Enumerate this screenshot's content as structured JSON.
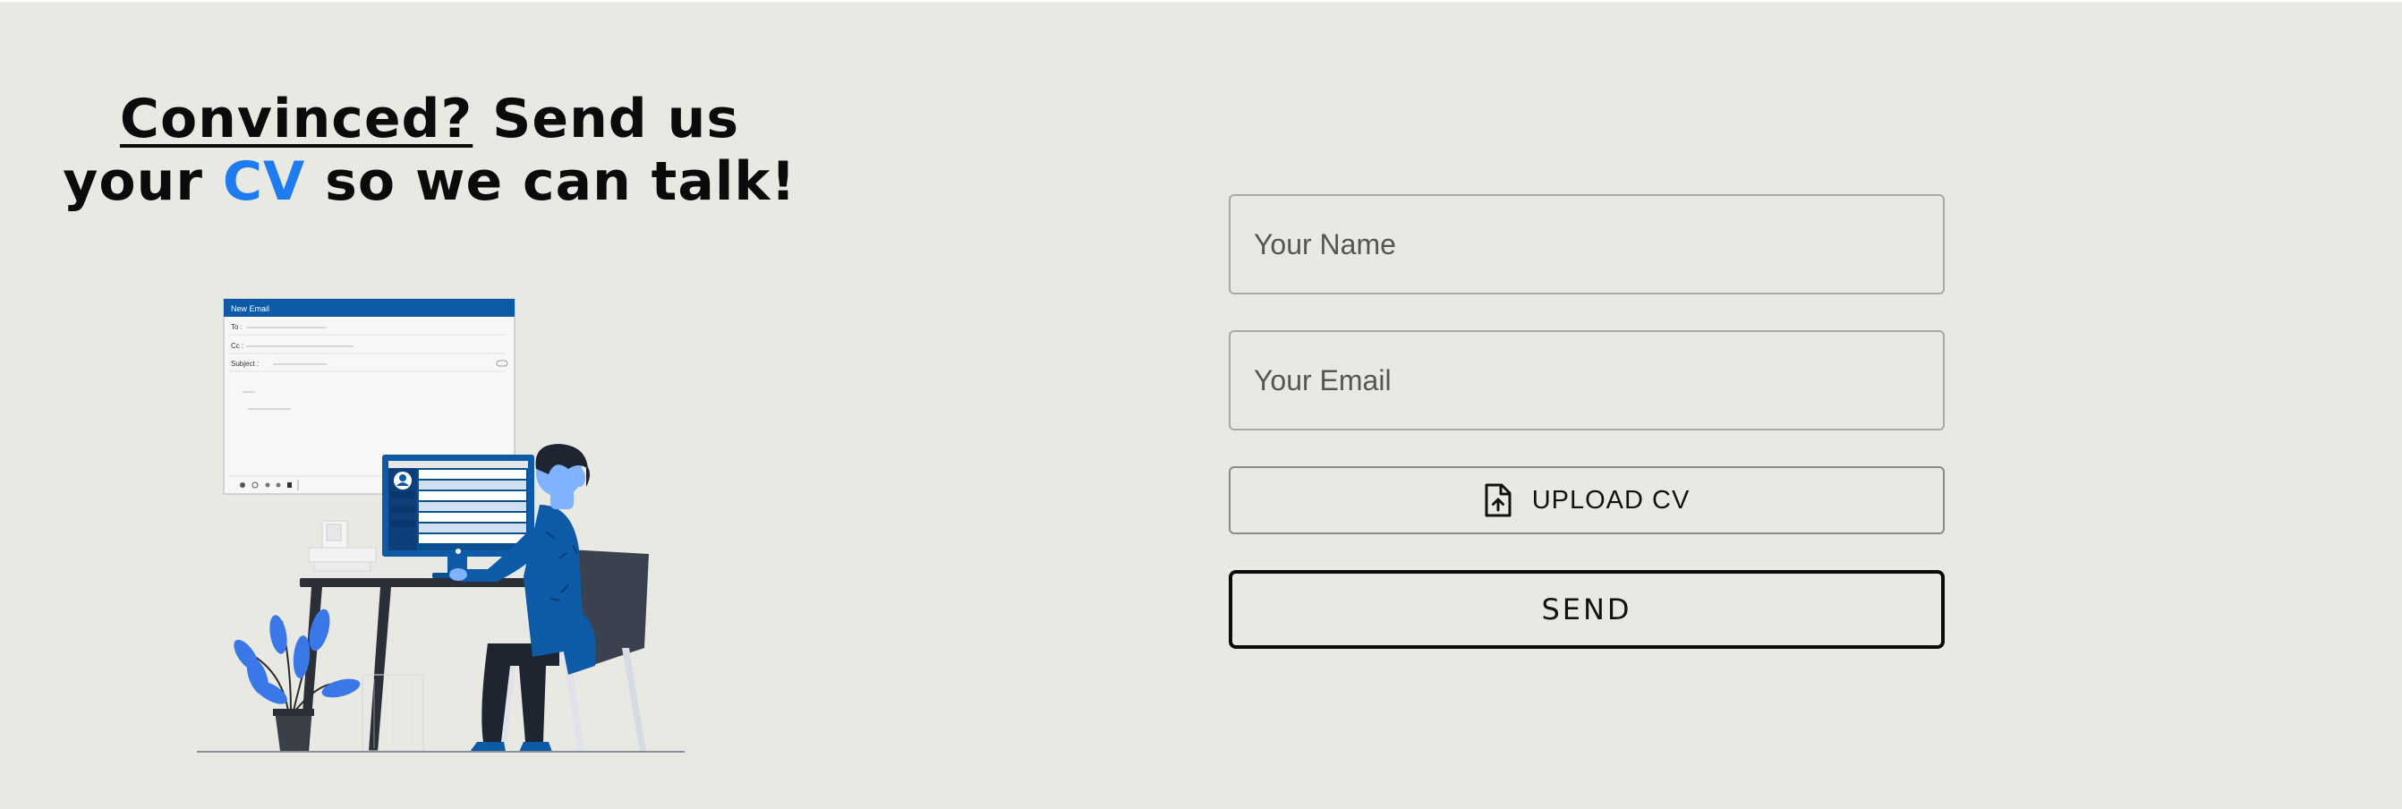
{
  "headline": {
    "part1": "Convinced?",
    "part2": " Send us your ",
    "part3": "CV",
    "part4": " so we can talk!"
  },
  "illustration": {
    "window_title": "New Email",
    "to_label": "To :",
    "cc_label": "Cc :",
    "subject_label": "Subject :"
  },
  "form": {
    "name_placeholder": "Your Name",
    "email_placeholder": "Your Email",
    "upload_label": "UPLOAD CV",
    "upload_icon": "file-upload-icon",
    "send_label": "SEND"
  },
  "colors": {
    "background": "#e9e9e4",
    "accent": "#1e7cf0",
    "illustration_blue": "#0d5aa7"
  }
}
